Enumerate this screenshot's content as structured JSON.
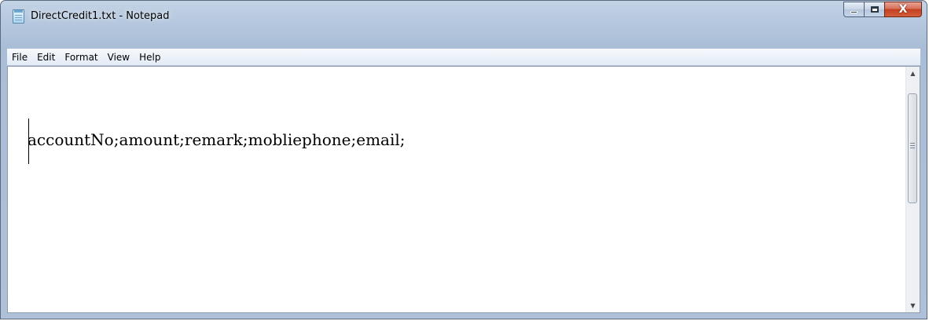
{
  "window": {
    "title": "DirectCredit1.txt - Notepad",
    "app_icon": "notepad-icon",
    "controls": {
      "minimize_icon": "minimize-icon",
      "maximize_icon": "maximize-icon",
      "close_icon": "close-icon",
      "close_glyph": "X"
    }
  },
  "menubar": {
    "items": [
      "File",
      "Edit",
      "Format",
      "View",
      "Help"
    ]
  },
  "editor": {
    "lines": [
      "accountNo;amount;remark;mobliephone;email;"
    ]
  },
  "scrollbar": {
    "up_glyph": "▲",
    "down_glyph": "▼"
  },
  "colors": {
    "title_bar": "#b4c7de",
    "close_button": "#c4401f",
    "editor_background": "#ffffff"
  }
}
